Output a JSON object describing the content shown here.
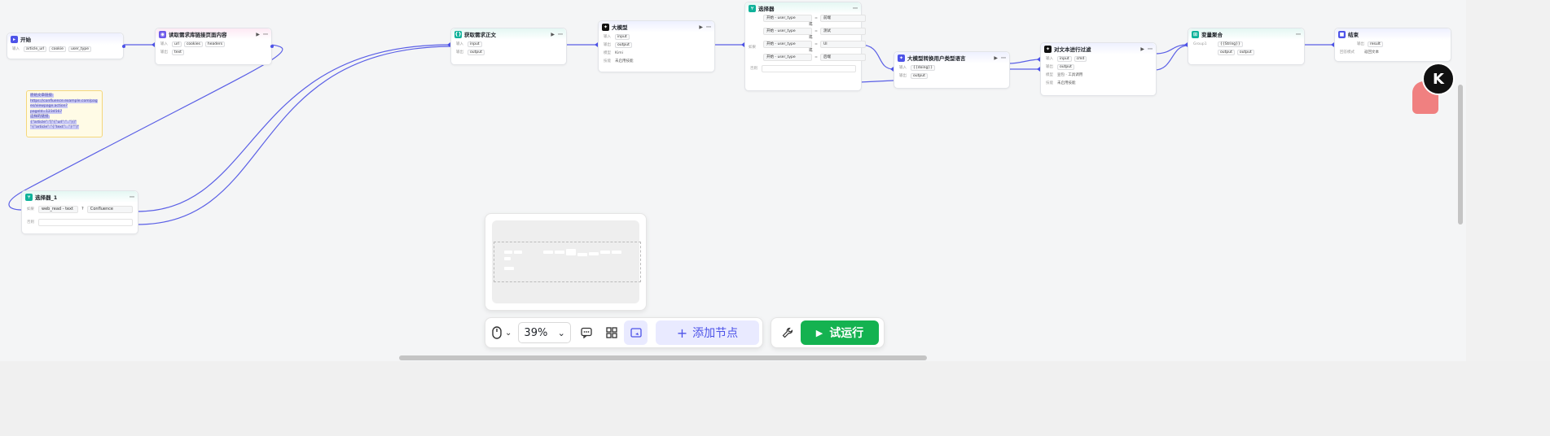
{
  "nodes": {
    "start": {
      "title": "开始",
      "input_label": "输入",
      "params": [
        "article_url",
        "cookie",
        "user_type"
      ]
    },
    "fetch": {
      "title": "读取需求库链接页面内容",
      "input_label": "输入",
      "output_label": "输出",
      "params": [
        "url",
        "cookies",
        "headers"
      ],
      "outputs": [
        "text"
      ]
    },
    "body": {
      "title": "获取需求正文",
      "input_label": "输入",
      "output_label": "输出",
      "params": [
        "input"
      ],
      "outputs": [
        "output"
      ]
    },
    "llm": {
      "title": "大模型",
      "input_label": "输入",
      "output_label": "输出",
      "model_label": "模型",
      "skill_label": "技能",
      "params": [
        "input"
      ],
      "outputs": [
        "output"
      ],
      "model": "Kimi",
      "skill": "未启用技能"
    },
    "selector": {
      "title": "选择器",
      "if_label": "如果",
      "else_label": "否则",
      "conditions": [
        {
          "field": "开始 - user_type",
          "op": "=",
          "value": "前端"
        },
        {
          "field": "开始 - user_type",
          "op": "=",
          "value": "测试"
        },
        {
          "field": "开始 - user_type",
          "op": "=",
          "value": "UI"
        },
        {
          "field": "开始 - user_type",
          "op": "=",
          "value": "后端"
        }
      ],
      "or_text": "或"
    },
    "convert": {
      "title": "大模型转换用户类型语言",
      "input_label": "输入",
      "output_label": "输出",
      "params": [
        "{{doing}}"
      ],
      "outputs": [
        "output"
      ]
    },
    "filter": {
      "title": "对文本进行过滤",
      "input_label": "输入",
      "output_label": "输出",
      "model_label": "模型",
      "skill_label": "技能",
      "params": [
        "input",
        "cmd"
      ],
      "outputs": [
        "output"
      ],
      "model": "豆包 · 工具调用",
      "skill": "未启用技能"
    },
    "aggregate": {
      "title": "变量聚合",
      "group_label": "Group1",
      "group_value": "{{String}}",
      "outputs": [
        "output",
        "output"
      ]
    },
    "end": {
      "title": "结束",
      "output_label": "输出",
      "mode_label": "回答模式",
      "params": [
        "result"
      ],
      "mode": "返回文本"
    },
    "selector1": {
      "title": "选择器_1",
      "if_label": "如果",
      "else_label": "否则",
      "condition_field": "web_read - text",
      "condition_op": "?",
      "condition_value": "Confluence"
    }
  },
  "note": {
    "lines": [
      "原始文章链接:",
      "https://confluence.example.com/pag",
      "es/viewpage.action?pageId=1234567",
      "这样的链接,",
      "{\"article\":\"[\"{\"url\":\"..\"}]\"",
      "\"{\"article\":\"{\"text\":..\"}\"\"]\""
    ]
  },
  "toolbar": {
    "zoom": "39%",
    "add_node": "添加节点",
    "run": "试运行"
  },
  "avatar": {
    "label": "K"
  },
  "colors": {
    "accent": "#4d53e8",
    "run": "#14b250",
    "edge": "#4d53e8"
  }
}
